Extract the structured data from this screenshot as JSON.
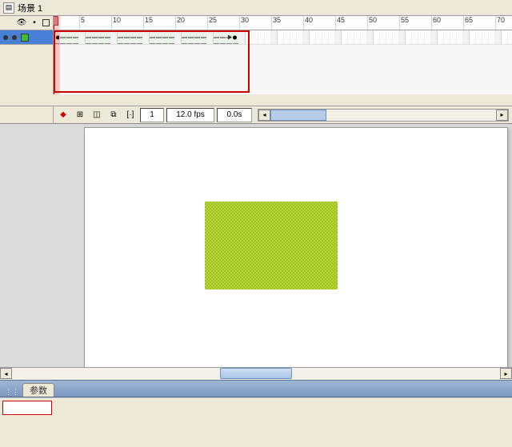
{
  "scene": {
    "title": "场景 1"
  },
  "timeline": {
    "ruler_marks": [
      5,
      10,
      15,
      20,
      25,
      30,
      35,
      40,
      45,
      50,
      55,
      60,
      65,
      70
    ],
    "frame_width": 8,
    "tween_start": 1,
    "tween_end": 29,
    "current_frame": "1",
    "fps": "12.0 fps",
    "elapsed": "0.0s"
  },
  "layer": {
    "name": ""
  },
  "properties": {
    "tab_label": "参数"
  }
}
